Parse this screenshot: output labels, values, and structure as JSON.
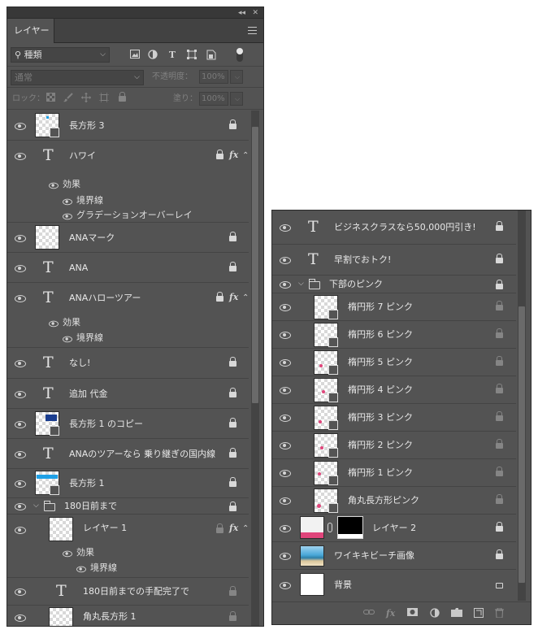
{
  "panel1": {
    "tab_label": "レイヤー",
    "filter_kind": "種類",
    "blend_mode": "通常",
    "opacity_label": "不透明度：",
    "opacity_value": "100%",
    "lock_label": "ロック：",
    "fill_label": "塗り：",
    "fill_value": "100%",
    "layers": [
      {
        "name": "長方形 3"
      },
      {
        "name": "ハワイ",
        "effects_label": "効果",
        "effects": [
          "境界線",
          "グラデーションオーバーレイ"
        ]
      },
      {
        "name": "ANAマーク"
      },
      {
        "name": "ANA"
      },
      {
        "name": "ANAハローツアー",
        "effects_label": "効果",
        "effects": [
          "境界線"
        ]
      },
      {
        "name": "なし!"
      },
      {
        "name": "追加 代金"
      },
      {
        "name": "長方形 1 のコピー"
      },
      {
        "name": "ANAのツアーなら 乗り継ぎの国内線"
      },
      {
        "name": "長方形 1"
      },
      {
        "name": "180日前まで"
      },
      {
        "name": "レイヤー 1",
        "effects_label": "効果",
        "effects": [
          "境界線"
        ]
      },
      {
        "name": "180日前までの手配完了で"
      },
      {
        "name": "角丸長方形 1"
      }
    ]
  },
  "panel2": {
    "layers": [
      {
        "name": "ビジネスクラスなら50,000円引き!"
      },
      {
        "name": "早割でおトク!"
      },
      {
        "name": "下部のピンク"
      },
      {
        "name": "楕円形 7 ピンク"
      },
      {
        "name": "楕円形 6 ピンク"
      },
      {
        "name": "楕円形 5 ピンク"
      },
      {
        "name": "楕円形 4 ピンク"
      },
      {
        "name": "楕円形 3 ピンク"
      },
      {
        "name": "楕円形 2 ピンク"
      },
      {
        "name": "楕円形 1 ピンク"
      },
      {
        "name": "角丸長方形ピンク"
      },
      {
        "name": "レイヤー 2"
      },
      {
        "name": "ワイキキビーチ画像"
      },
      {
        "name": "背景"
      }
    ]
  },
  "colors": {
    "panel_bg": "#535353",
    "pink": "#e0457b",
    "blue": "#1ea0e6",
    "navy": "#1a3d8f"
  },
  "glyphs": {
    "text_layer": "T",
    "fx": "fx",
    "collapse": "◂◂",
    "close": "✕",
    "search": "⚲",
    "caret": "⌵",
    "chevron_down": "⌵",
    "up": "⌃"
  }
}
